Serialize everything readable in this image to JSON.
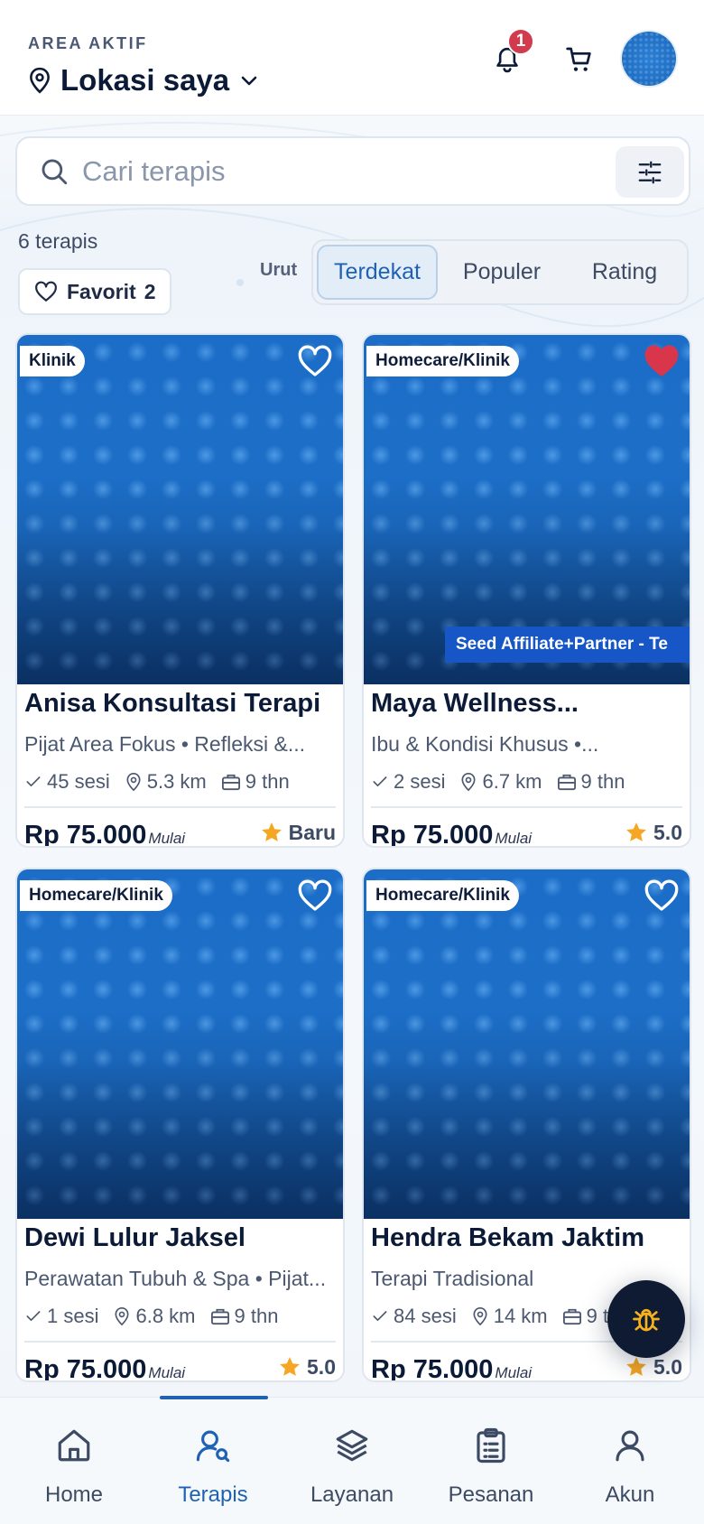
{
  "header": {
    "area_label": "AREA AKTIF",
    "location": "Lokasi saya",
    "notification_count": "1"
  },
  "search": {
    "placeholder": "Cari terapis"
  },
  "summary": {
    "count_text": "6 terapis",
    "favorite_label": "Favorit",
    "favorite_count": "2"
  },
  "sort": {
    "label": "Urut",
    "options": [
      "Terdekat",
      "Populer",
      "Rating"
    ],
    "active": "Terdekat"
  },
  "cards": [
    {
      "tag": "Klinik",
      "favorited": false,
      "promo": "",
      "name": "Anisa Konsultasi Terapi",
      "subtitle": "Pijat Area Fokus • Refleksi &...",
      "sessions": "45 sesi",
      "distance": "5.3 km",
      "experience": "9 thn",
      "price": "Rp 75.000",
      "price_note": "Mulai",
      "rating": "Baru"
    },
    {
      "tag": "Homecare/Klinik",
      "favorited": true,
      "promo": "Seed Affiliate+Partner - Te",
      "name": "Maya Wellness...",
      "subtitle": "Ibu & Kondisi Khusus •...",
      "sessions": "2 sesi",
      "distance": "6.7 km",
      "experience": "9 thn",
      "price": "Rp 75.000",
      "price_note": "Mulai",
      "rating": "5.0"
    },
    {
      "tag": "Homecare/Klinik",
      "favorited": false,
      "promo": "",
      "name": "Dewi Lulur Jaksel",
      "subtitle": "Perawatan Tubuh & Spa • Pijat...",
      "sessions": "1 sesi",
      "distance": "6.8 km",
      "experience": "9 thn",
      "price": "Rp 75.000",
      "price_note": "Mulai",
      "rating": "5.0"
    },
    {
      "tag": "Homecare/Klinik",
      "favorited": false,
      "promo": "",
      "name": "Hendra Bekam Jaktim",
      "subtitle": "Terapi Tradisional",
      "sessions": "84 sesi",
      "distance": "14 km",
      "experience": "9 thn",
      "price": "Rp 75.000",
      "price_note": "Mulai",
      "rating": "5.0"
    }
  ],
  "bottom_nav": {
    "items": [
      {
        "label": "Home",
        "icon": "home-icon"
      },
      {
        "label": "Terapis",
        "icon": "user-search-icon"
      },
      {
        "label": "Layanan",
        "icon": "layers-icon"
      },
      {
        "label": "Pesanan",
        "icon": "clipboard-icon"
      },
      {
        "label": "Akun",
        "icon": "user-icon"
      }
    ],
    "active": "Terapis"
  },
  "colors": {
    "primary": "#1f62b3",
    "badge": "#d23b4e",
    "promo": "#1656c6",
    "star": "#f5a623",
    "heart_active": "#d9364c",
    "fab": "#0f1b33"
  }
}
